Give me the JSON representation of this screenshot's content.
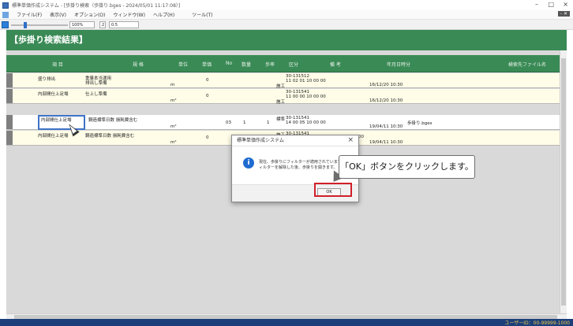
{
  "app": {
    "title": "標準単価作成システム - [歩掛り検索（歩掛り.bges - 2024/05/01 11:17:08）]",
    "window_controls": [
      "–",
      "□",
      "×"
    ]
  },
  "menu": {
    "items": [
      "ファイル(F)",
      "表示(V)",
      "オプション(O)",
      "ウィンドウ(W)",
      "ヘルプ(H)",
      "ツール(T)"
    ],
    "right": "- ✕"
  },
  "toolbar": {
    "zoom": "100%",
    "dropdown_1": "2",
    "dropdown_2": "0.5"
  },
  "panel": {
    "title": "【歩掛り検索結果】"
  },
  "table": {
    "headers": [
      "項 目",
      "規 格",
      "単位",
      "単価",
      "No",
      "数量",
      "歩率",
      "区分",
      "備 考",
      "年月日時分",
      "検索先ファイル名"
    ],
    "rows": [
      {
        "item": "盛り排出",
        "spec_1": "重量本当運用",
        "spec_2": "排出し準備",
        "unit": "m",
        "price": "0",
        "no": "",
        "qty": "",
        "rate": "",
        "kubun": "施工",
        "biko_1": "30-131512",
        "biko_2": "11  02  01  10  00  00",
        "date": "16/12/20 10:30",
        "file": ""
      },
      {
        "item": "内部間仕上足場",
        "spec_1": "仕上し準備",
        "spec_2": "",
        "unit": "m²",
        "price": "0",
        "no": "",
        "qty": "",
        "rate": "",
        "kubun": "施工",
        "biko_1": "30-131541",
        "biko_2": "11  00  00  10  00  00",
        "date": "16/12/20 10:30",
        "file": ""
      },
      {
        "item": "内部間仕上足場",
        "spec_1": "鋼造標準日数 損耗費含む",
        "spec_2": "",
        "unit": "m²",
        "price": "",
        "no": "03",
        "qty": "1",
        "rate": "1",
        "kubun": "標準",
        "biko_1": "30-131541",
        "biko_2": "14  00  05  10  00  00",
        "date": "19/04/11 10:30",
        "file": "歩掛り.bges"
      },
      {
        "item": "内部間仕上足場",
        "spec_1": "鋼造標準日数 損耗費含む",
        "spec_2": "",
        "unit": "m²",
        "price": "0",
        "no": "",
        "qty": "",
        "rate": "",
        "kubun": "施工",
        "biko_1": "30-131541",
        "biko_2": "00",
        "date": "19/04/11 10:30",
        "file": ""
      }
    ]
  },
  "dialog": {
    "title": "標準単価作成システム",
    "message": "現在、歩掛りにフィルターが適用されています。全フィルターを解除した後、歩掛りを開きます。",
    "ok": "OK"
  },
  "callout": {
    "text": "「OK」ボタンをクリックします。"
  },
  "status": {
    "user_id": "ユーザーID：00-99999-1000"
  }
}
